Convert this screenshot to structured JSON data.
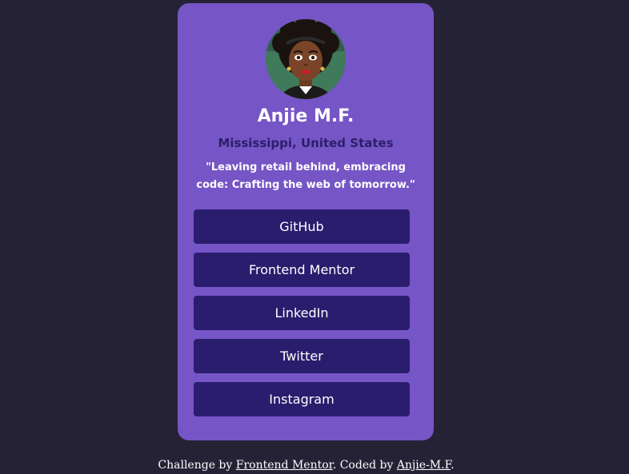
{
  "profile": {
    "name": "Anjie M.F.",
    "location": "Mississippi, United States",
    "bio": "\"Leaving retail behind, embracing code: Crafting the web of tomorrow.\"",
    "avatar_icon": "avatar-illustration"
  },
  "links": [
    {
      "label": "GitHub"
    },
    {
      "label": "Frontend Mentor"
    },
    {
      "label": "LinkedIn"
    },
    {
      "label": "Twitter"
    },
    {
      "label": "Instagram"
    }
  ],
  "attribution": {
    "prefix": "Challenge by ",
    "challenge_link": "Frontend Mentor",
    "middle": ". Coded by ",
    "author_link": "Anjie-M.F",
    "suffix": "."
  },
  "colors": {
    "page_background": "#262236",
    "card_background": "#7655c6",
    "button_background": "#2a1d6e",
    "location_text": "#2b1f6b"
  }
}
